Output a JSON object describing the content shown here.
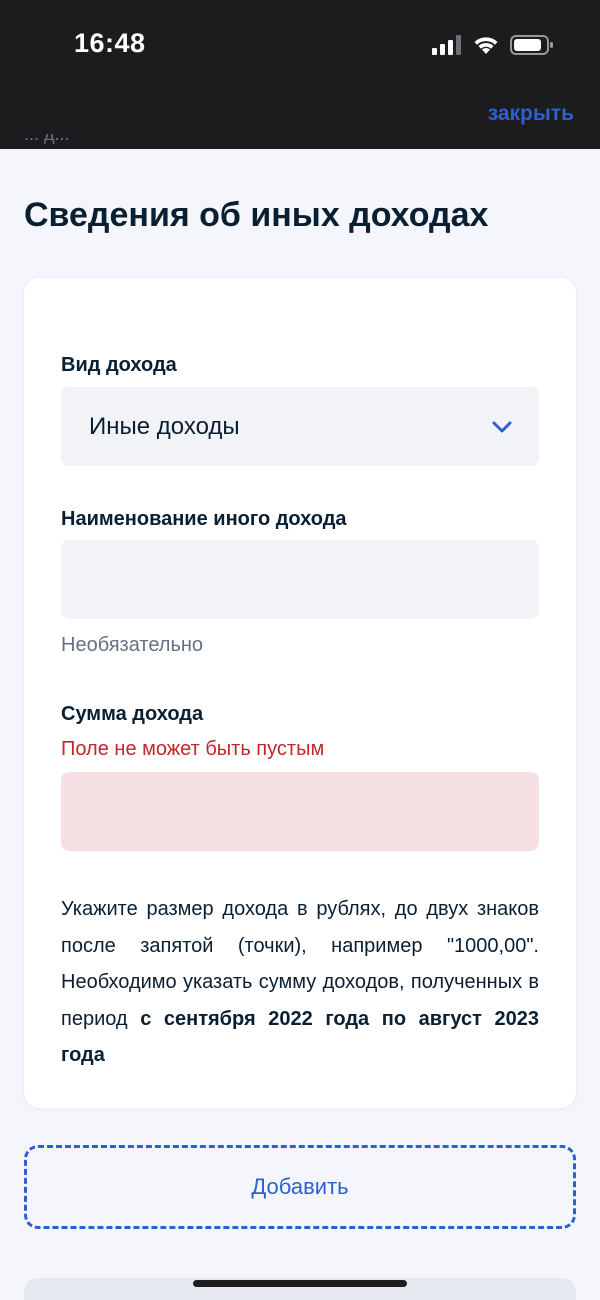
{
  "status_bar": {
    "time": "16:48"
  },
  "header": {
    "close_label": "закрыть",
    "cropped_prev_text": "... д..."
  },
  "page": {
    "title": "Сведения об иных доходах"
  },
  "form": {
    "income_type": {
      "label": "Вид дохода",
      "value": "Иные доходы"
    },
    "other_income_name": {
      "label": "Наименование иного дохода",
      "value": "",
      "hint": "Необязательно"
    },
    "income_amount": {
      "label": "Сумма дохода",
      "error": "Поле не может быть пустым",
      "value": ""
    },
    "description": {
      "text": "Укажите размер дохода в рублях, до двух знаков после запятой (точки), например \"1000,00\". Необходимо указать сумму доходов, полученных в период ",
      "bold": "с сентября 2022 года по август 2023 года"
    }
  },
  "actions": {
    "add_label": "Добавить"
  },
  "colors": {
    "accent": "#2f5fd0",
    "error": "#c1272d",
    "error_bg": "#f7e0e3",
    "input_bg": "#f1f3f7",
    "text": "#0b1f33",
    "muted": "#66727f"
  },
  "icons": {
    "signal": "cellular-signal-icon",
    "wifi": "wifi-icon",
    "battery": "battery-icon",
    "chevron": "chevron-down-icon"
  }
}
